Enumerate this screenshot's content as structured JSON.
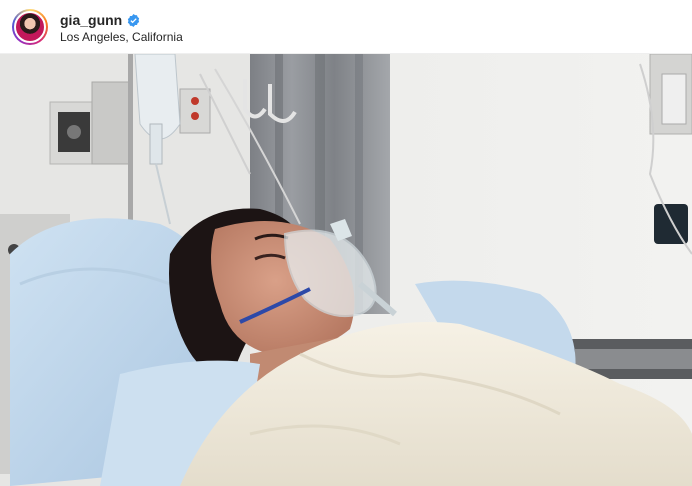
{
  "post": {
    "username": "gia_gunn",
    "verified": true,
    "location": "Los Angeles, California"
  },
  "photo": {
    "subject": "hospital-patient-oxygen-mask"
  },
  "icons": {
    "verified": "verified-badge-icon",
    "avatar": "avatar"
  },
  "colors": {
    "verified_blue": "#3897f0",
    "text": "#262626"
  }
}
